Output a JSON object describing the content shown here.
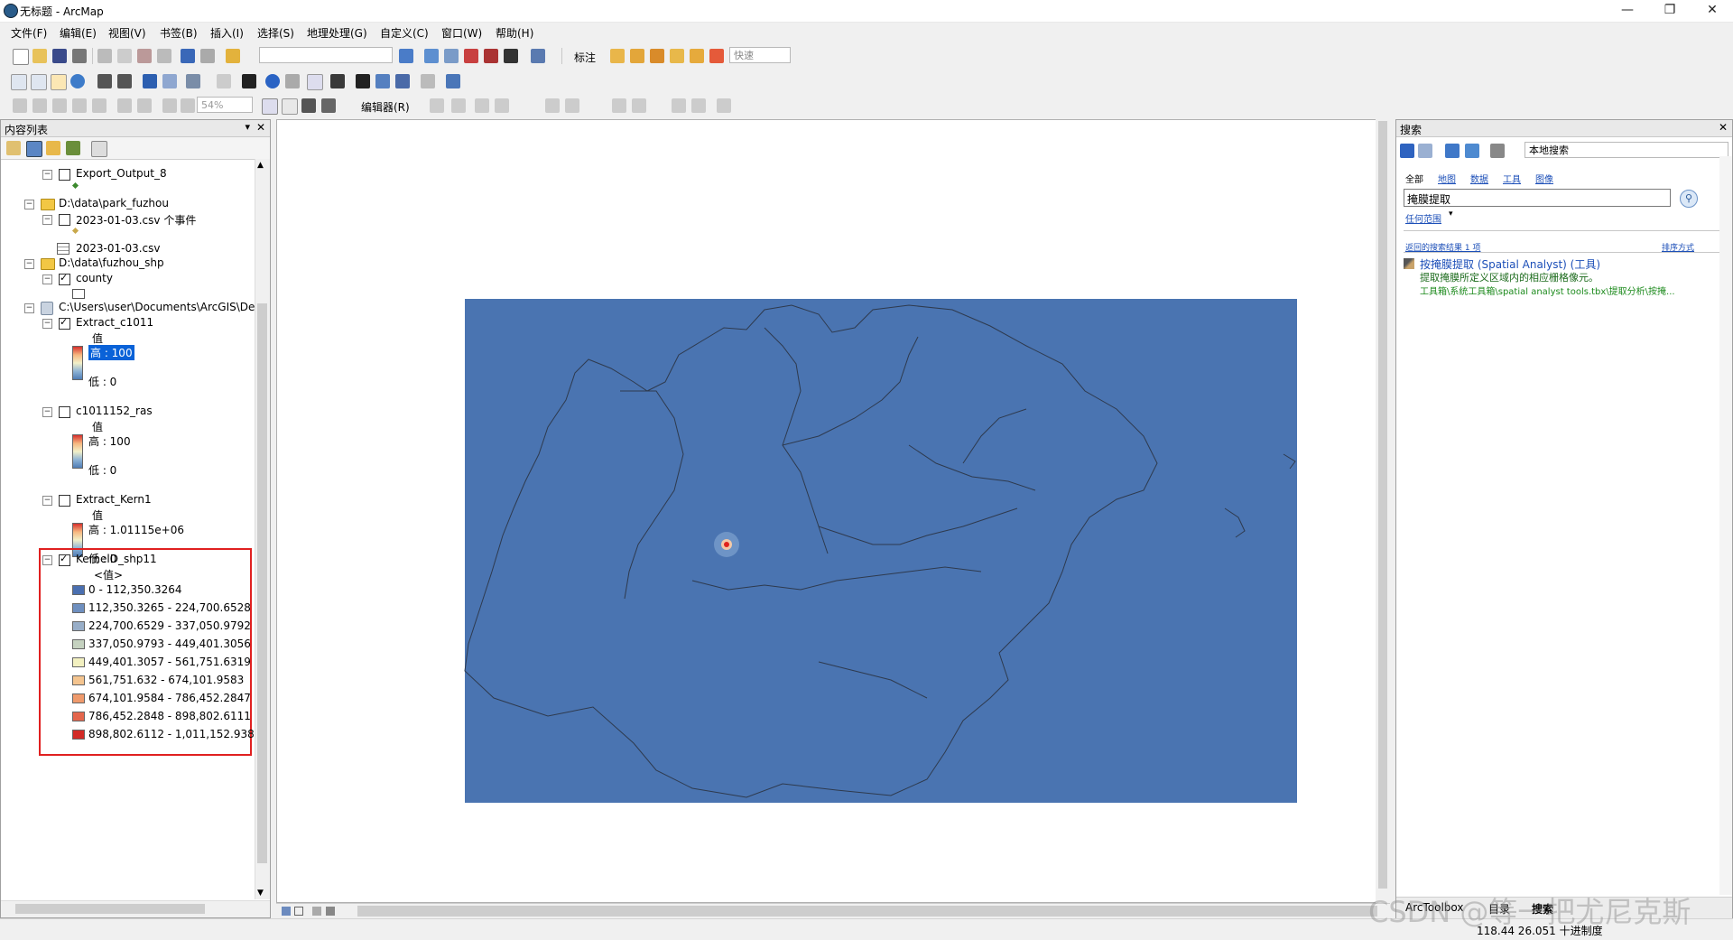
{
  "window": {
    "title": "无标题 - ArcMap",
    "minimize": "—",
    "maximize": "❐",
    "close": "✕"
  },
  "menus": [
    "文件(F)",
    "编辑(E)",
    "视图(V)",
    "书签(B)",
    "插入(I)",
    "选择(S)",
    "地理处理(G)",
    "自定义(C)",
    "窗口(W)",
    "帮助(H)"
  ],
  "toolbar": {
    "label_menu": "标注",
    "quick_dropdown": "快速",
    "scale_value": "54%",
    "editor_menu": "编辑器(R)"
  },
  "toc": {
    "title": "内容列表",
    "pin": "▾",
    "close": "✕",
    "items": [
      {
        "label": "Export_Output_8"
      },
      {
        "label": "D:\\data\\park_fuzhou"
      },
      {
        "label": "2023-01-03.csv 个事件"
      },
      {
        "label": "2023-01-03.csv"
      },
      {
        "label": "D:\\data\\fuzhou_shp"
      },
      {
        "label": "county"
      },
      {
        "label": "C:\\Users\\user\\Documents\\ArcGIS\\Def"
      },
      {
        "label": "Extract_c1011",
        "value_label": "值",
        "high": "高 : 100",
        "low": "低 : 0"
      },
      {
        "label": "c1011152_ras",
        "value_label": "值",
        "high": "高 : 100",
        "low": "低 : 0"
      },
      {
        "label": "Extract_Kern1",
        "value_label": "值",
        "high": "高 : 1.01115e+06",
        "low": "低 : 0"
      },
      {
        "label": "KernelD_shp11",
        "value_label": "<值>"
      }
    ],
    "classes": [
      {
        "label": "0 - 112,350.3264",
        "color": "#4a6fb0"
      },
      {
        "label": "112,350.3265 - 224,700.6528",
        "color": "#6e8fbf"
      },
      {
        "label": "224,700.6529 - 337,050.9792",
        "color": "#98aec8"
      },
      {
        "label": "337,050.9793 - 449,401.3056",
        "color": "#c5d2c0"
      },
      {
        "label": "449,401.3057 - 561,751.6319",
        "color": "#f2f0c0"
      },
      {
        "label": "561,751.632 - 674,101.9583",
        "color": "#f4c48f"
      },
      {
        "label": "674,101.9584 - 786,452.2847",
        "color": "#ef9a6c"
      },
      {
        "label": "786,452.2848 - 898,802.6111",
        "color": "#e4664c"
      },
      {
        "label": "898,802.6112 - 1,011,152.938",
        "color": "#d22a26"
      }
    ]
  },
  "search": {
    "title": "搜索",
    "scope": "本地搜索",
    "tabs": [
      "全部",
      "地图",
      "数据",
      "工具",
      "图像"
    ],
    "query": "掩膜提取",
    "any_extent": "任何范围",
    "result_count": "返回的搜索结果 1 项",
    "sort": "排序方式",
    "result_title": "按掩膜提取 (Spatial Analyst) (工具)",
    "result_desc": "提取掩膜所定义区域内的相应栅格像元。",
    "result_path": "工具箱\\系统工具箱\\spatial analyst tools.tbx\\提取分析\\按掩..."
  },
  "bottom_tabs": [
    "ArcToolbox",
    "目录",
    "搜索"
  ],
  "status": {
    "coords": "118.44  26.051 十进制度"
  },
  "watermark": "CSDN @等一把尤尼克斯",
  "colors": {
    "map_background": "#4a74b1",
    "selection_box": "#e02020",
    "hotspot": "#e0231c"
  }
}
